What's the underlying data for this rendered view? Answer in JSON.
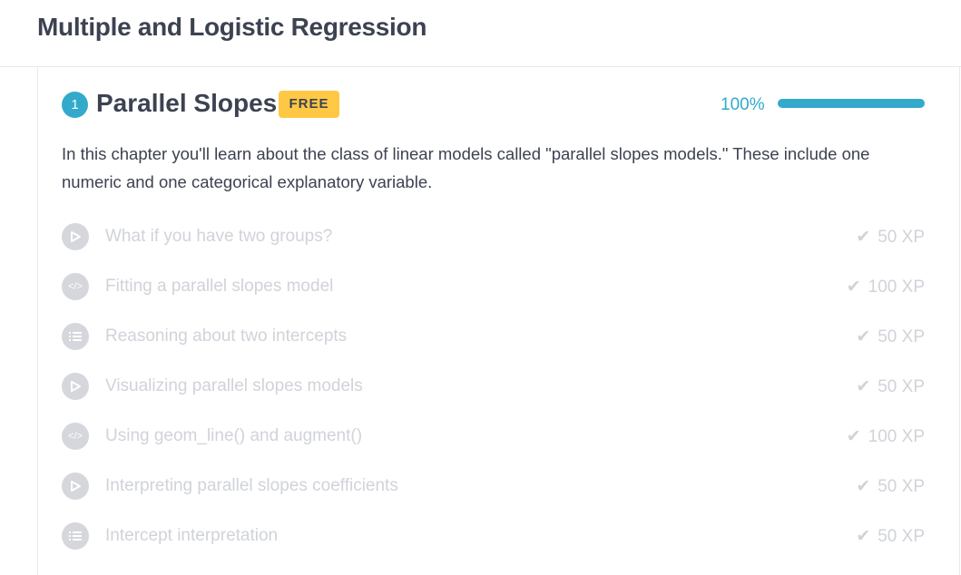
{
  "course": {
    "title": "Multiple and Logistic Regression"
  },
  "chapter": {
    "number": "1",
    "title": "Parallel Slopes",
    "badge": "FREE",
    "progress_label": "100%",
    "progress": 100,
    "description": "In this chapter you'll learn about the class of linear models called \"parallel slopes models.\" These include one numeric and one categorical explanatory variable.",
    "exercises": [
      {
        "icon": "play-icon",
        "label": "What if you have two groups?",
        "xp": "50 XP"
      },
      {
        "icon": "code-icon",
        "label": "Fitting a parallel slopes model",
        "xp": "100 XP"
      },
      {
        "icon": "list-icon",
        "label": "Reasoning about two intercepts",
        "xp": "50 XP"
      },
      {
        "icon": "play-icon",
        "label": "Visualizing parallel slopes models",
        "xp": "50 XP"
      },
      {
        "icon": "code-icon",
        "label": "Using geom_line() and augment()",
        "xp": "100 XP"
      },
      {
        "icon": "play-icon",
        "label": "Interpreting parallel slopes coefficients",
        "xp": "50 XP"
      },
      {
        "icon": "list-icon",
        "label": "Intercept interpretation",
        "xp": "50 XP"
      }
    ]
  },
  "colors": {
    "accent": "#33aacc",
    "badge": "#ffc844",
    "text": "#3d4251",
    "muted": "#d0d3d9"
  }
}
